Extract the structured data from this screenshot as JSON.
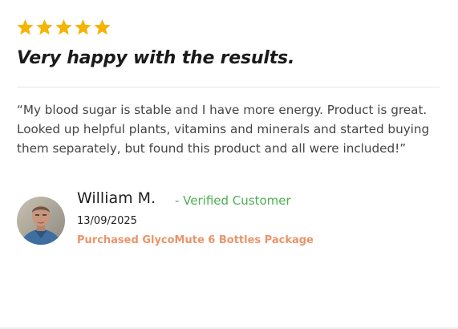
{
  "review": {
    "rating": 5,
    "max_rating": 5,
    "title": "Very happy with the results.",
    "body": "“My blood sugar is stable and I have more energy. Product is great. Looked up helpful plants, vitamins and minerals and started buying them separately, but found this product and all were included!”",
    "reviewer": {
      "name": "William M.",
      "verified_label": "- Verified Customer",
      "date": "13/09/2025",
      "purchase": "Purchased GlycoMute 6 Bottles Package"
    }
  },
  "colors": {
    "star": "#f5b400",
    "verified": "#4caf50",
    "purchase": "#e8956a",
    "title": "#1a1a1a",
    "body": "#444444"
  },
  "icons": {
    "star": "star-icon",
    "avatar": "reviewer-photo"
  }
}
